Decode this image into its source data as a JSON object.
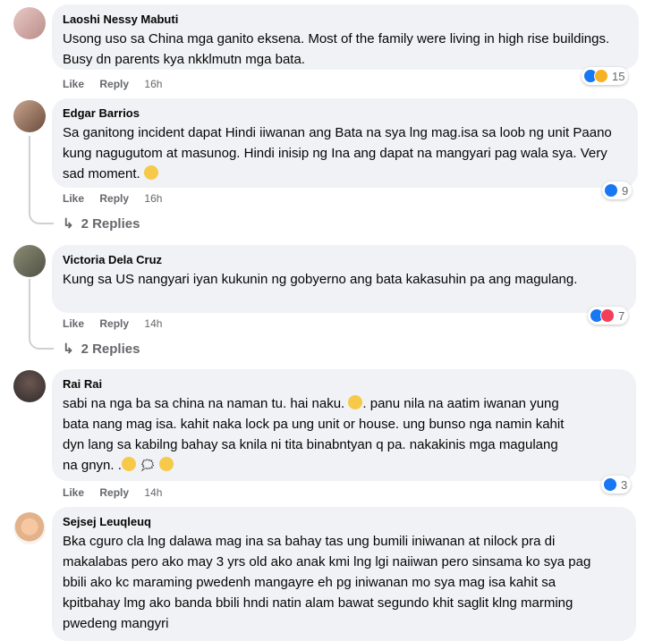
{
  "comments": [
    {
      "author": "Laoshi Nessy Mabuti",
      "text": "Usong uso sa China mga ganito eksena. Most of the family were living in high rise buildings. Busy dn parents kya nkklmutn mga bata.",
      "like": "Like",
      "reply": "Reply",
      "time": "16h",
      "reaction_count": "15",
      "reactions": [
        "like",
        "sad"
      ]
    },
    {
      "author": "Edgar Barrios",
      "text": "Sa ganitong incident dapat Hindi iiwanan ang Bata na sya lng mag.isa sa loob ng unit Paano kung nagugutom at masunog. Hindi inisip ng Ina ang dapat na mangyari pag wala sya. Very sad moment.",
      "like": "Like",
      "reply": "Reply",
      "time": "16h",
      "reaction_count": "9",
      "reactions": [
        "like"
      ],
      "replies_label": "2 Replies"
    },
    {
      "author": "Victoria Dela Cruz",
      "text": "Kung sa US nangyari iyan kukunin ng gobyerno ang bata kakasuhin pa ang magulang.",
      "like": "Like",
      "reply": "Reply",
      "time": "14h",
      "reaction_count": "7",
      "reactions": [
        "like",
        "love"
      ],
      "replies_label": "2 Replies"
    },
    {
      "author": "Rai Rai",
      "text_lines": [
        "sabi na nga ba sa china na naman tu. hai naku.",
        ". panu nila na aatim iwanan yung",
        "bata nang mag isa. kahit naka lock pa ung unit or house. ung bunso nga namin kahit",
        "dyn lang sa kabilng bahay sa knila ni tita binabntyan q pa. nakakinis mga magulang",
        "na gnyn. ."
      ],
      "like": "Like",
      "reply": "Reply",
      "time": "14h",
      "reaction_count": "3",
      "reactions": [
        "like"
      ]
    },
    {
      "author": "Sejsej Leuqleuq",
      "text": "Bka cguro cla lng dalawa mag ina sa bahay tas ung bumili iniwanan at nilock pra di makalabas pero ako may 3 yrs old ako anak kmi lng lgi naiiwan pero sinsama ko sya pag bbili ako kc maraming pwedenh mangayre eh pg iniwanan mo sya mag isa kahit sa kpitbahay lmg ako banda bbili hndi natin alam bawat segundo khit saglit klng marming pwedeng mangyri"
    }
  ]
}
